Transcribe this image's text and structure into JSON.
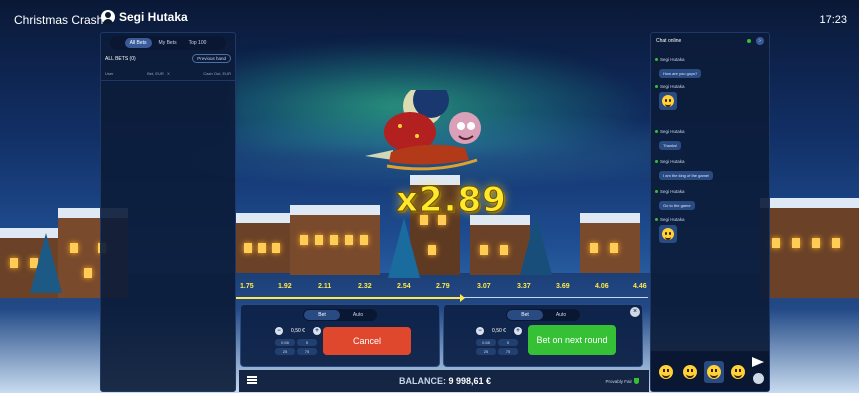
{
  "header": {
    "game_title": "Christmas Crash",
    "username": "Segi Hutaka",
    "clock": "17:23"
  },
  "bets_panel": {
    "tabs": [
      "All Bets",
      "My Bets",
      "Top 100"
    ],
    "active_tab": "All Bets",
    "all_bets_label": "ALL BETS (0)",
    "previous_hand_label": "Previous hand",
    "columns": [
      "User",
      "Bet, EUR",
      "Cash Out, EUR"
    ],
    "column_x_label": "X"
  },
  "game": {
    "multiplier": "x2.89",
    "scale": [
      "1.75",
      "1.92",
      "2.11",
      "2.32",
      "2.54",
      "2.79",
      "3.07",
      "3.37",
      "3.69",
      "4.06",
      "4.46"
    ],
    "progress": 0.55
  },
  "bet_left": {
    "modes": [
      "Bet",
      "Auto"
    ],
    "active_mode": "Bet",
    "amount": "0,50 €",
    "quick": [
      "0.58",
      "5",
      "25",
      "75"
    ],
    "action": "Cancel"
  },
  "bet_right": {
    "modes": [
      "Bet",
      "Auto"
    ],
    "active_mode": "Bet",
    "amount": "0,50 €",
    "quick": [
      "0.58",
      "5",
      "25",
      "75"
    ],
    "action": "Bet on next round"
  },
  "footer": {
    "balance_label": "BALANCE:",
    "balance_value": "9 998,61 €",
    "provably_fair": "Provably Fair"
  },
  "chat": {
    "title": "Chat online",
    "messages": [
      {
        "user": "Segi Hutaka",
        "text": "How are you guys?"
      },
      {
        "user": "Segi Hutaka",
        "emoji": "smile-emoji"
      },
      {
        "user": "Segi Hutaka",
        "text": "Thanks!"
      },
      {
        "user": "Segi Hutaka",
        "text": "I am the king of the game!"
      },
      {
        "user": "Segi Hutaka",
        "text": "Go to the game"
      },
      {
        "user": "Segi Hutaka",
        "emoji": "grin-emoji"
      }
    ]
  },
  "colors": {
    "accent_yellow": "#ffe82e",
    "cancel_red": "#e0482e",
    "bet_green": "#36c035",
    "panel_bg": "#0c1c3a"
  }
}
